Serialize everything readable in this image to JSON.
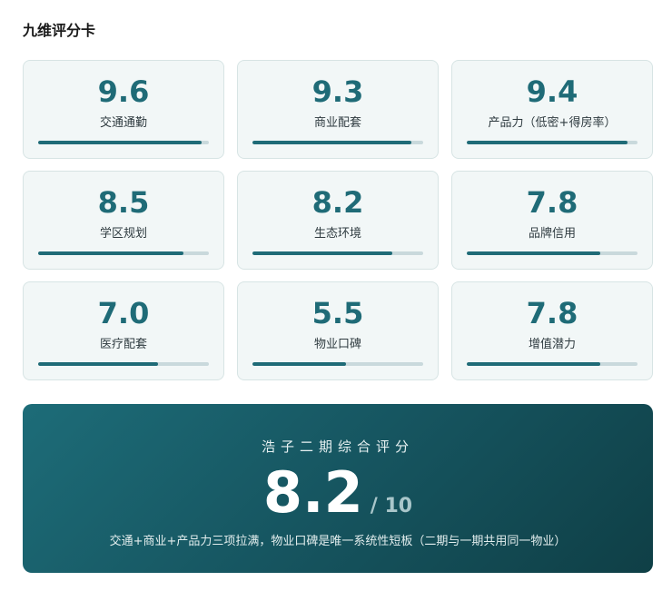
{
  "page": {
    "title": "九维评分卡"
  },
  "dimensions": [
    {
      "score": "9.6",
      "label": "交通通勤",
      "ratio": 0.96
    },
    {
      "score": "9.3",
      "label": "商业配套",
      "ratio": 0.93
    },
    {
      "score": "9.4",
      "label": "产品力（低密+得房率）",
      "ratio": 0.94
    },
    {
      "score": "8.5",
      "label": "学区规划",
      "ratio": 0.85
    },
    {
      "score": "8.2",
      "label": "生态环境",
      "ratio": 0.82
    },
    {
      "score": "7.8",
      "label": "品牌信用",
      "ratio": 0.78
    },
    {
      "score": "7.0",
      "label": "医疗配套",
      "ratio": 0.7
    },
    {
      "score": "5.5",
      "label": "物业口碑",
      "ratio": 0.55
    },
    {
      "score": "7.8",
      "label": "增值潜力",
      "ratio": 0.78
    }
  ],
  "summary": {
    "heading": "浩子二期综合评分",
    "total": "8.2",
    "max": "/ 10",
    "note": "交通+商业+产品力三项拉满，物业口碑是唯一系统性短板（二期与一期共用同一物业）"
  },
  "colors": {
    "accent": "#1f6b77",
    "track": "#c9d9dc",
    "card_bg": "#f2f7f7"
  }
}
